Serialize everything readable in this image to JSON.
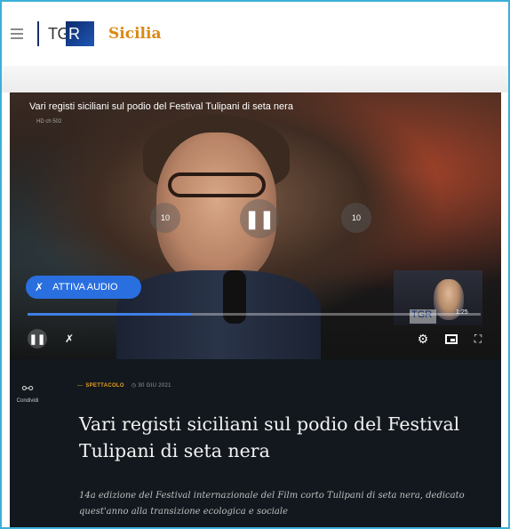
{
  "header": {
    "logo_tg": "TG",
    "logo_r": "R",
    "region": "Sicilia"
  },
  "video": {
    "title": "Vari registi siciliani sul podio del Festival Tulipani di seta nera",
    "channel_tag": "HD ch 502",
    "rewind_label": "10",
    "forward_label": "10",
    "audio_button": "ATTIVA AUDIO",
    "sign_logo": "TGR",
    "sign_time": "1:25",
    "progress_fraction": 0.36
  },
  "article": {
    "share_label": "Condividi",
    "category": "SPETTACOLO",
    "date": "30 GIU 2021",
    "title": "Vari registi siciliani sul podio del Festival Tulipani di seta nera",
    "subtitle": "14a edizione del Festival internazionale del Film corto Tulipani di seta nera, dedicato quest'anno alla transizione ecologica e sociale"
  },
  "colors": {
    "frame": "#3bb0d6",
    "brand_orange": "#d98a14",
    "accent_blue": "#2a6fe0",
    "article_bg": "#12181e"
  },
  "icons": [
    "menu-icon",
    "rewind-10-icon",
    "pause-icon",
    "forward-10-icon",
    "mute-icon",
    "settings-icon",
    "pip-icon",
    "fullscreen-icon",
    "share-icon",
    "clock-icon"
  ]
}
